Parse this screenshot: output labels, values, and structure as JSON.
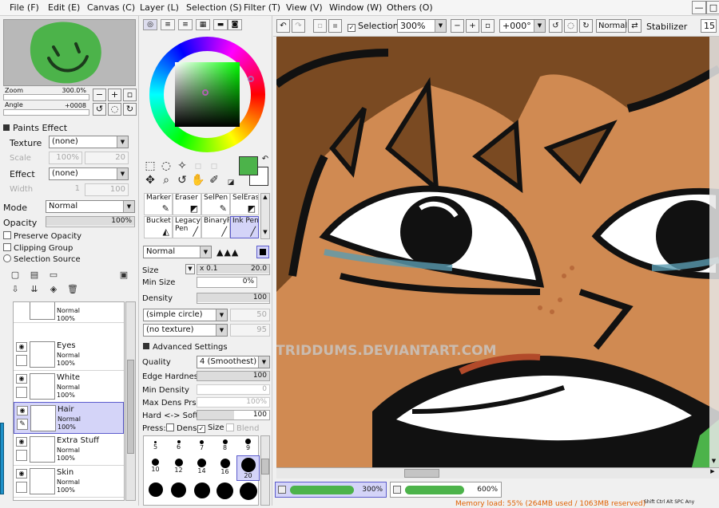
{
  "menus": [
    "File (F)",
    "Edit (E)",
    "Canvas (C)",
    "Layer (L)",
    "Selection (S)",
    "Filter (T)",
    "View (V)",
    "Window (W)",
    "Others (O)"
  ],
  "window_buttons": [
    "—",
    "□"
  ],
  "navigator": {
    "zoom_label": "Zoom",
    "zoom_value": "300.0%",
    "angle_label": "Angle",
    "angle_value": "+0008"
  },
  "paints_effect": {
    "header": "Paints Effect",
    "texture_label": "Texture",
    "texture_value": "(none)",
    "scale_label": "Scale",
    "scale_value": "100%",
    "scale_num": "20",
    "effect_label": "Effect",
    "effect_value": "(none)",
    "width_label": "Width",
    "width_value": "1",
    "width_num": "100"
  },
  "layer_props": {
    "mode_label": "Mode",
    "mode_value": "Normal",
    "opacity_label": "Opacity",
    "opacity_value": "100%",
    "preserve_opacity": "Preserve Opacity",
    "clipping_group": "Clipping Group",
    "selection_source": "Selection Source"
  },
  "layers": [
    {
      "name": "",
      "mode": "Normal",
      "opacity": "100%",
      "selected": false
    },
    {
      "name": "Eyes",
      "mode": "Normal",
      "opacity": "100%",
      "selected": false
    },
    {
      "name": "White",
      "mode": "Normal",
      "opacity": "100%",
      "selected": false
    },
    {
      "name": "Hair",
      "mode": "Normal",
      "opacity": "100%",
      "selected": true
    },
    {
      "name": "Extra Stuff",
      "mode": "Normal",
      "opacity": "100%",
      "selected": false
    },
    {
      "name": "Skin",
      "mode": "Normal",
      "opacity": "100%",
      "selected": false
    }
  ],
  "colors": {
    "primary": "#4cb34a",
    "secondary": "#ffffff",
    "skin": "#d08a52",
    "hair": "#7a4a22",
    "selection": "#d4d4f8"
  },
  "brushes": [
    {
      "label": "Marker",
      "selected": false
    },
    {
      "label": "Eraser",
      "selected": false
    },
    {
      "label": "SelPen",
      "selected": false
    },
    {
      "label": "SelEras",
      "selected": false
    },
    {
      "label": "Bucket",
      "selected": false
    },
    {
      "label": "Legacy Pen",
      "selected": false
    },
    {
      "label": "BinaryPe",
      "selected": false
    },
    {
      "label": "Ink Pen",
      "selected": true
    }
  ],
  "brush_settings": {
    "blend_mode": "Normal",
    "size_label": "Size",
    "size_mult": "x 0.1",
    "size_value": "20.0",
    "min_size_label": "Min Size",
    "min_size_value": "0%",
    "density_label": "Density",
    "density_value": "100",
    "shape": "(simple circle)",
    "shape_num": "50",
    "texture": "(no texture)",
    "texture_num": "95",
    "advanced_header": "Advanced Settings",
    "quality_label": "Quality",
    "quality_value": "4 (Smoothest)",
    "edge_hardness_label": "Edge Hardness",
    "edge_hardness_value": "100",
    "min_density_label": "Min Density",
    "min_density_value": "0",
    "max_dens_label": "Max Dens Prs.",
    "max_dens_value": "100%",
    "hard_soft_label": "Hard <-> Soft",
    "hard_soft_value": "100",
    "press_label": "Press:",
    "press_dens": "Dens",
    "press_size": "Size",
    "press_blend": "Blend"
  },
  "brush_sizes": [
    "5",
    "6",
    "7",
    "8",
    "9",
    "10",
    "12",
    "14",
    "16",
    "20"
  ],
  "toolbar": {
    "selection_label": "Selection",
    "zoom_value": "300%",
    "angle_value": "+000°",
    "blend_value": "Normal",
    "stabilizer_label": "Stabilizer",
    "stabilizer_value": "15"
  },
  "canvas_tabs": [
    {
      "zoom": "300%"
    },
    {
      "zoom": "600%"
    }
  ],
  "watermark": "© STRIDDUMS.DEVIANTART.COM",
  "status": {
    "memory": "Memory load: 55% (264MB used / 1063MB reserved)",
    "keys": [
      "Shift",
      "Ctrl",
      "Alt",
      "SPC",
      "Any"
    ]
  }
}
